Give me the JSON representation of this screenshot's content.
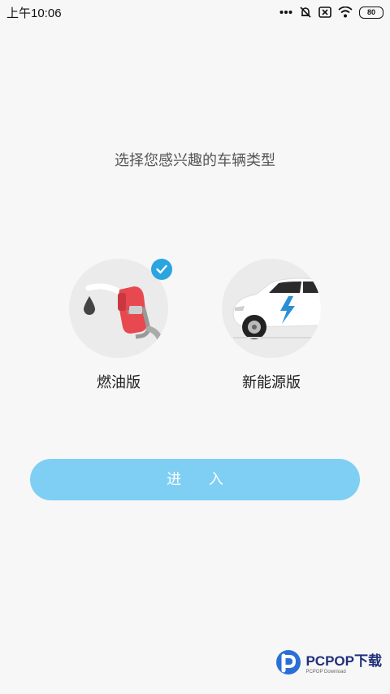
{
  "status_bar": {
    "time": "上午10:06",
    "battery": "80",
    "icons": [
      "more-dots-icon",
      "mute-icon",
      "sim-error-icon",
      "wifi-icon",
      "battery-icon"
    ]
  },
  "prompt": "选择您感兴趣的车辆类型",
  "options": [
    {
      "label": "燃油版",
      "icon": "fuel-pump-icon",
      "selected": true
    },
    {
      "label": "新能源版",
      "icon": "electric-car-icon",
      "selected": false
    }
  ],
  "enter_button": {
    "label": "进 入"
  },
  "watermark": {
    "title": "PCPOP下载",
    "subtitle": "PCPOP Download"
  },
  "colors": {
    "background": "#f7f7f7",
    "accent": "#2aa5e0",
    "button": "#7fcff4",
    "fuel_red": "#e8484f",
    "circle": "#ebebeb"
  }
}
